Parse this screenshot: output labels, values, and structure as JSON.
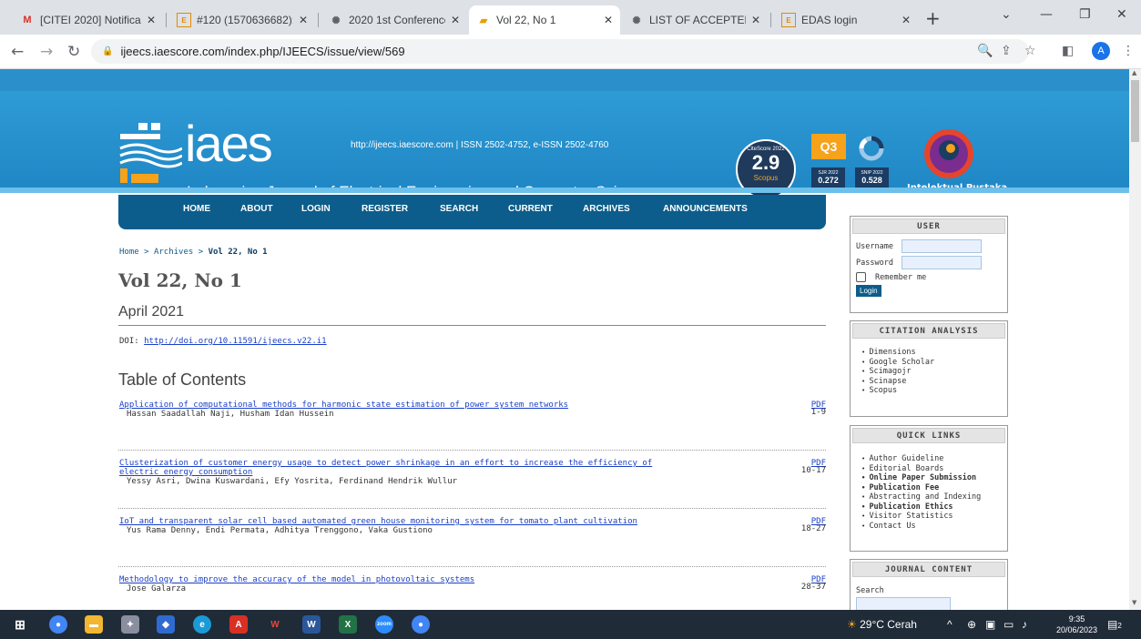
{
  "browser": {
    "tabs": [
      {
        "label": "[CITEI 2020] Notificati",
        "favicon": "gmail-icon",
        "active": false
      },
      {
        "label": "#120 (1570636682): A",
        "favicon": "edas-icon",
        "active": false
      },
      {
        "label": "2020 1st Conference o",
        "favicon": "conference-icon",
        "active": false
      },
      {
        "label": "Vol 22, No 1",
        "favicon": "iaes-icon",
        "active": true
      },
      {
        "label": "LIST OF ACCEPTED AN",
        "favicon": "conference-icon",
        "active": false
      },
      {
        "label": "EDAS login",
        "favicon": "edas-icon",
        "active": false
      }
    ],
    "url": "ijeecs.iaescore.com/index.php/IJEECS/issue/view/569",
    "profile_initial": "A"
  },
  "header": {
    "logo_text": "iaes",
    "journal_title": "Indonesian Journal of Electrical Engineering and Computer Science",
    "issn_line": "http://ijeecs.iaescore.com   |  ISSN 2502-4752, e-ISSN 2502-4760",
    "citescore_label": "CiteScore 2022",
    "citescore_value": "2.9",
    "citescore_source": "Scopus",
    "quartile": "Q3",
    "sjr_label": "SJR 2022",
    "sjr_value": "0.272",
    "snip_label": "SNIP 2022",
    "snip_value": "0.528",
    "publisher_name": "Intelektual Pustaka",
    "publisher_sub": "Media Utama"
  },
  "nav": {
    "items": [
      "HOME",
      "ABOUT",
      "LOGIN",
      "REGISTER",
      "SEARCH",
      "CURRENT",
      "ARCHIVES",
      "ANNOUNCEMENTS"
    ]
  },
  "breadcrumb": {
    "home": "Home",
    "sep": ">",
    "archives": "Archives",
    "current": "Vol 22, No 1"
  },
  "issue": {
    "title": "Vol 22, No 1",
    "date": "April 2021",
    "doi_label": "DOI:",
    "doi_link": "http://doi.org/10.11591/ijeecs.v22.i1",
    "toc_heading": "Table of Contents"
  },
  "articles": [
    {
      "title": "Application of computational methods for harmonic state estimation of power system networks",
      "authors": "Hassan Saadallah Naji, Husham Idan Hussein",
      "pdf": "PDF",
      "pages": "1-9"
    },
    {
      "title": "Clusterization of customer energy usage to detect power shrinkage in an effort to increase the efficiency of electric energy consumption",
      "authors": "Yessy Asri, Dwina Kuswardani, Efy Yosrita, Ferdinand Hendrik Wullur",
      "pdf": "PDF",
      "pages": "10-17"
    },
    {
      "title": "IoT and transparent solar cell based automated green house monitoring system for tomato plant cultivation",
      "authors": "Yus Rama Denny, Endi Permata, Adhitya Trenggono, Vaka Gustiono",
      "pdf": "PDF",
      "pages": "18-27"
    },
    {
      "title": "Methodology to improve the accuracy of the model in photovoltaic systems",
      "authors": "Jose Galarza",
      "pdf": "PDF",
      "pages": "28-37"
    }
  ],
  "sidebar": {
    "user": {
      "heading": "USER",
      "username_label": "Username",
      "password_label": "Password",
      "remember_label": "Remember me",
      "login_button": "Login"
    },
    "citation": {
      "heading": "CITATION ANALYSIS",
      "items": [
        "Dimensions",
        "Google Scholar",
        "Scimagojr",
        "Scinapse",
        "Scopus"
      ]
    },
    "quick_links": {
      "heading": "QUICK LINKS",
      "items": [
        "Author Guideline",
        "Editorial Boards",
        "Online Paper Submission",
        "Publication Fee",
        "Abstracting and Indexing",
        "Publication Ethics",
        "Visitor Statistics",
        "Contact Us"
      ]
    },
    "journal_content": {
      "heading": "JOURNAL CONTENT",
      "search_label": "Search"
    }
  },
  "taskbar": {
    "weather": "29°C  Cerah",
    "time": "9:35",
    "date": "20/06/2023",
    "notifications": "2"
  },
  "colors": {
    "nav_bg": "#0c5d8b",
    "banner": "#2e9bd6",
    "link": "#1a3fc7",
    "taskbar": "#202b38"
  }
}
